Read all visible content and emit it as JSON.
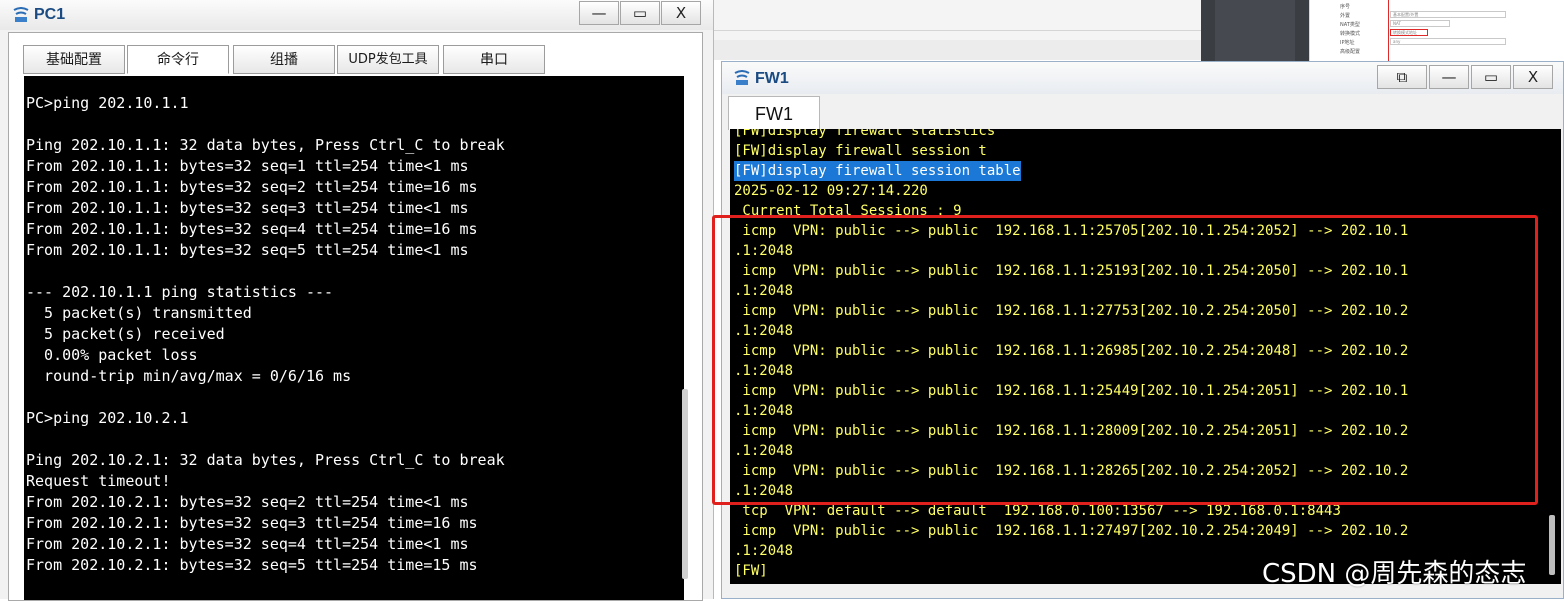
{
  "pc1": {
    "title": "PC1",
    "controls": {
      "minimize": "—",
      "maximize": "▭",
      "close": "X"
    },
    "tabs": [
      "基础配置",
      "命令行",
      "组播",
      "UDP发包工具",
      "串口"
    ],
    "active_tab": "命令行",
    "terminal_lines": [
      "PC>ping 202.10.1.1",
      "",
      "Ping 202.10.1.1: 32 data bytes, Press Ctrl_C to break",
      "From 202.10.1.1: bytes=32 seq=1 ttl=254 time<1 ms",
      "From 202.10.1.1: bytes=32 seq=2 ttl=254 time=16 ms",
      "From 202.10.1.1: bytes=32 seq=3 ttl=254 time<1 ms",
      "From 202.10.1.1: bytes=32 seq=4 ttl=254 time=16 ms",
      "From 202.10.1.1: bytes=32 seq=5 ttl=254 time<1 ms",
      "",
      "--- 202.10.1.1 ping statistics ---",
      "  5 packet(s) transmitted",
      "  5 packet(s) received",
      "  0.00% packet loss",
      "  round-trip min/avg/max = 0/6/16 ms",
      "",
      "PC>ping 202.10.2.1",
      "",
      "Ping 202.10.2.1: 32 data bytes, Press Ctrl_C to break",
      "Request timeout!",
      "From 202.10.2.1: bytes=32 seq=2 ttl=254 time<1 ms",
      "From 202.10.2.1: bytes=32 seq=3 ttl=254 time=16 ms",
      "From 202.10.2.1: bytes=32 seq=4 ttl=254 time<1 ms",
      "From 202.10.2.1: bytes=32 seq=5 ttl=254 time=15 ms"
    ]
  },
  "fw1": {
    "title": "FW1",
    "controls": {
      "restore": "⧉",
      "minimize": "—",
      "maximize": "▭",
      "close": "X"
    },
    "tab": "FW1",
    "terminal_lines": [
      "[FW]display firewall statistics",
      "[FW]display firewall session t",
      "[FW]display firewall session table",
      "2025-02-12 09:27:14.220",
      " Current Total Sessions : 9",
      " icmp  VPN: public --> public  192.168.1.1:25705[202.10.1.254:2052] --> 202.10.1",
      ".1:2048",
      " icmp  VPN: public --> public  192.168.1.1:25193[202.10.1.254:2050] --> 202.10.1",
      ".1:2048",
      " icmp  VPN: public --> public  192.168.1.1:27753[202.10.2.254:2050] --> 202.10.2",
      ".1:2048",
      " icmp  VPN: public --> public  192.168.1.1:26985[202.10.2.254:2048] --> 202.10.2",
      ".1:2048",
      " icmp  VPN: public --> public  192.168.1.1:25449[202.10.1.254:2051] --> 202.10.1",
      ".1:2048",
      " icmp  VPN: public --> public  192.168.1.1:28009[202.10.2.254:2051] --> 202.10.2",
      ".1:2048",
      " icmp  VPN: public --> public  192.168.1.1:28265[202.10.2.254:2052] --> 202.10.2",
      ".1:2048",
      " tcp  VPN: default --> default  192.168.0.100:13567 --> 192.168.0.1:8443",
      " icmp  VPN: public --> public  192.168.1.1:27497[202.10.2.254:2049] --> 202.10.2",
      ".1:2048",
      "[FW]"
    ],
    "selected_line": "[FW]display firewall session table"
  },
  "background": {
    "form_labels": [
      "序号",
      "外置",
      "NAT类型",
      "转换模式",
      "IP地址",
      "高级配置"
    ],
    "form_values": [
      "基本配置/外置",
      "NAT",
      "NATPA",
      "转换模式地址",
      "any"
    ]
  },
  "watermark": "CSDN @周先森的态志",
  "colors": {
    "terminal_bg": "#000000",
    "pc_text": "#ffffff",
    "fw_text": "#ffff66",
    "selection": "#1b78d6",
    "highlight_box": "#e0201c"
  }
}
